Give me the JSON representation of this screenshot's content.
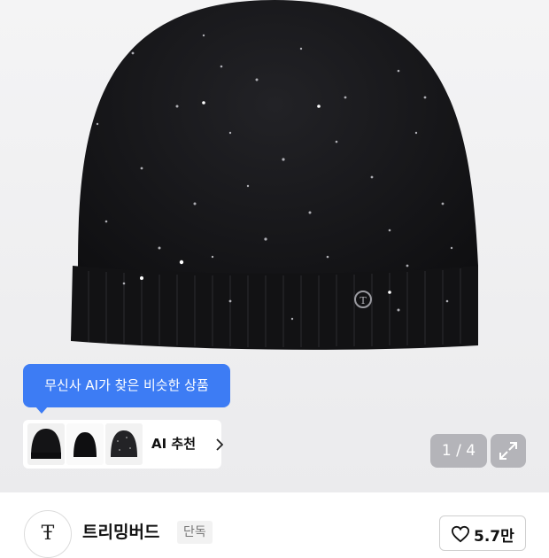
{
  "hero": {
    "ai_tooltip": "무신사 AI가 찾은 비슷한 상품",
    "ai_recommend_label": "AI 추천",
    "pager": "1 / 4",
    "thumbnails": [
      "black-beanie-thumb",
      "black-beanie-thumb",
      "black-beanie-thumb"
    ]
  },
  "brand": {
    "logo_text": "Ŧ",
    "name": "트리밍버드",
    "tag": "단독",
    "likes": "5.7만"
  },
  "colors": {
    "accent": "#3d7cf4",
    "product": "#151517"
  },
  "icons": [
    "chevron-right-icon",
    "expand-icon",
    "heart-icon"
  ]
}
